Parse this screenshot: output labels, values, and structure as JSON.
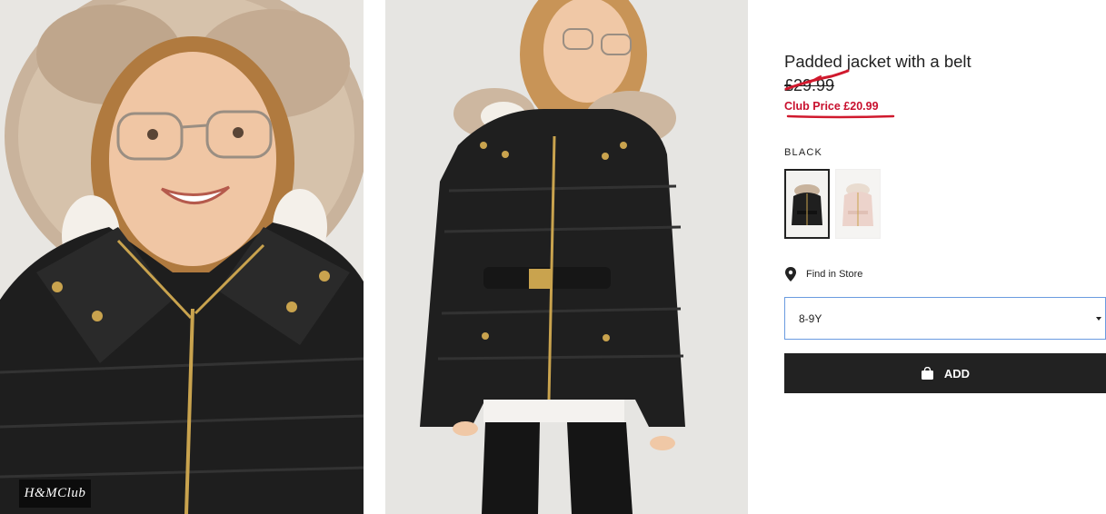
{
  "product": {
    "title": "Padded jacket with a belt",
    "old_price": "£29.99",
    "club_price": "Club Price £20.99",
    "color_name": "BLACK",
    "swatches": [
      {
        "name": "black-jacket",
        "color": "#1f1f1f",
        "selected": true
      },
      {
        "name": "pink-jacket",
        "color": "#ecd3cb",
        "selected": false
      }
    ]
  },
  "store": {
    "label": "Find in Store",
    "icon": "map-pin-icon"
  },
  "size_select": {
    "value": "8-9Y",
    "icon": "caret-down-icon"
  },
  "add_button": {
    "label": "ADD",
    "icon": "shopping-bag-icon"
  },
  "badge": {
    "text": "H&MClub"
  },
  "colors": {
    "accent_red": "#d0192d",
    "button_bg": "#222222",
    "select_border": "#6a9be0"
  }
}
